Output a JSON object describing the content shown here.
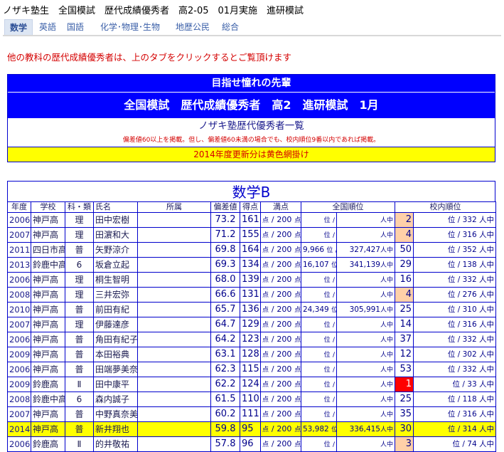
{
  "page_title": "ノザキ塾生　全国模試　歴代成績優秀者　高2-05　01月実施　進研模試",
  "tabs": [
    {
      "label": "数学",
      "active": true
    },
    {
      "label": "英語",
      "active": false
    },
    {
      "label": "国語",
      "active": false
    },
    {
      "label": "化学･物理･生物",
      "active": false
    },
    {
      "label": "地歴公民",
      "active": false
    },
    {
      "label": "総合",
      "active": false
    }
  ],
  "notice": "他の教科の歴代成績優秀者は、上のタブをクリックするとご覧頂けます",
  "hero": {
    "line1": "目指せ憧れの先輩",
    "line2": "全国模試　歴代成績優秀者　高2　進研模試　1月",
    "line3": "ノザキ塾歴代優秀者一覧",
    "line4": "偏差値60以上を掲載。但し、偏差値60未満の場合でも、校内順位9番以内であれば掲載。",
    "line5": "2014年度更新分は黄色網掛け"
  },
  "subject_title": "数学B",
  "headers": {
    "year": "年度",
    "school": "学校",
    "type": "科・類",
    "name": "氏名",
    "affil": "所属",
    "dev": "偏差値",
    "score": "得点",
    "max": "満点",
    "national": "全国順位",
    "school_rank": "校内順位"
  },
  "units": {
    "point": "点",
    "slash": "/",
    "rank_suffix": "位",
    "people_in": "人中"
  },
  "rows": [
    {
      "year": "2006",
      "school": "神戸高",
      "type": "理",
      "name": "田中宏樹",
      "dev": "73.2",
      "score": "161",
      "max": "200",
      "nat_rank": "",
      "nat_total": "",
      "sch_rank": "2",
      "sch_total": "332",
      "mark": "orange",
      "hilite": false
    },
    {
      "year": "2007",
      "school": "神戸高",
      "type": "理",
      "name": "田濵和大",
      "dev": "71.2",
      "score": "155",
      "max": "200",
      "nat_rank": "",
      "nat_total": "",
      "sch_rank": "4",
      "sch_total": "316",
      "mark": "orange",
      "hilite": false
    },
    {
      "year": "2011",
      "school": "四日市高",
      "type": "普",
      "name": "矢野涼介",
      "dev": "69.8",
      "score": "164",
      "max": "200",
      "nat_rank": "9,966",
      "nat_total": "327,427",
      "sch_rank": "50",
      "sch_total": "352",
      "mark": "",
      "hilite": false
    },
    {
      "year": "2013",
      "school": "鈴鹿中高",
      "type": "6",
      "name": "坂倉立起",
      "dev": "69.3",
      "score": "134",
      "max": "200",
      "nat_rank": "16,107",
      "nat_total": "341,139",
      "sch_rank": "29",
      "sch_total": "138",
      "mark": "",
      "hilite": false
    },
    {
      "year": "2006",
      "school": "神戸高",
      "type": "理",
      "name": "桐生智明",
      "dev": "68.0",
      "score": "139",
      "max": "200",
      "nat_rank": "",
      "nat_total": "",
      "sch_rank": "16",
      "sch_total": "332",
      "mark": "",
      "hilite": false
    },
    {
      "year": "2008",
      "school": "神戸高",
      "type": "理",
      "name": "三井宏弥",
      "dev": "66.6",
      "score": "131",
      "max": "200",
      "nat_rank": "",
      "nat_total": "",
      "sch_rank": "4",
      "sch_total": "276",
      "mark": "orange",
      "hilite": false
    },
    {
      "year": "2010",
      "school": "神戸高",
      "type": "普",
      "name": "前田有紀",
      "dev": "65.7",
      "score": "136",
      "max": "200",
      "nat_rank": "24,349",
      "nat_total": "305,991",
      "sch_rank": "25",
      "sch_total": "310",
      "mark": "",
      "hilite": false
    },
    {
      "year": "2007",
      "school": "神戸高",
      "type": "理",
      "name": "伊藤達彦",
      "dev": "64.7",
      "score": "129",
      "max": "200",
      "nat_rank": "",
      "nat_total": "",
      "sch_rank": "14",
      "sch_total": "316",
      "mark": "",
      "hilite": false
    },
    {
      "year": "2006",
      "school": "神戸高",
      "type": "普",
      "name": "角田有紀子",
      "dev": "64.2",
      "score": "123",
      "max": "200",
      "nat_rank": "",
      "nat_total": "",
      "sch_rank": "37",
      "sch_total": "332",
      "mark": "",
      "hilite": false
    },
    {
      "year": "2009",
      "school": "神戸高",
      "type": "普",
      "name": "本田裕典",
      "dev": "63.1",
      "score": "128",
      "max": "200",
      "nat_rank": "",
      "nat_total": "",
      "sch_rank": "12",
      "sch_total": "302",
      "mark": "",
      "hilite": false
    },
    {
      "year": "2006",
      "school": "神戸高",
      "type": "普",
      "name": "田端夢美奈",
      "dev": "62.3",
      "score": "115",
      "max": "200",
      "nat_rank": "",
      "nat_total": "",
      "sch_rank": "53",
      "sch_total": "332",
      "mark": "",
      "hilite": false
    },
    {
      "year": "2009",
      "school": "鈴鹿高",
      "type": "Ⅱ",
      "name": "田中康平",
      "dev": "62.2",
      "score": "124",
      "max": "200",
      "nat_rank": "",
      "nat_total": "",
      "sch_rank": "1",
      "sch_total": "33",
      "mark": "red",
      "hilite": false
    },
    {
      "year": "2008",
      "school": "鈴鹿中高",
      "type": "6",
      "name": "森内誠子",
      "dev": "61.5",
      "score": "110",
      "max": "200",
      "nat_rank": "",
      "nat_total": "",
      "sch_rank": "25",
      "sch_total": "118",
      "mark": "",
      "hilite": false
    },
    {
      "year": "2007",
      "school": "神戸高",
      "type": "普",
      "name": "中野真奈美",
      "dev": "60.2",
      "score": "111",
      "max": "200",
      "nat_rank": "",
      "nat_total": "",
      "sch_rank": "35",
      "sch_total": "316",
      "mark": "",
      "hilite": false
    },
    {
      "year": "2014",
      "school": "神戸高",
      "type": "普",
      "name": "新井翔也",
      "dev": "59.8",
      "score": "95",
      "max": "200",
      "nat_rank": "53,982",
      "nat_total": "336,415",
      "sch_rank": "30",
      "sch_total": "314",
      "mark": "",
      "hilite": true
    },
    {
      "year": "2006",
      "school": "鈴鹿高",
      "type": "Ⅱ",
      "name": "的井敬祐",
      "dev": "57.8",
      "score": "96",
      "max": "200",
      "nat_rank": "",
      "nat_total": "",
      "sch_rank": "3",
      "sch_total": "74",
      "mark": "orange",
      "hilite": false
    }
  ]
}
